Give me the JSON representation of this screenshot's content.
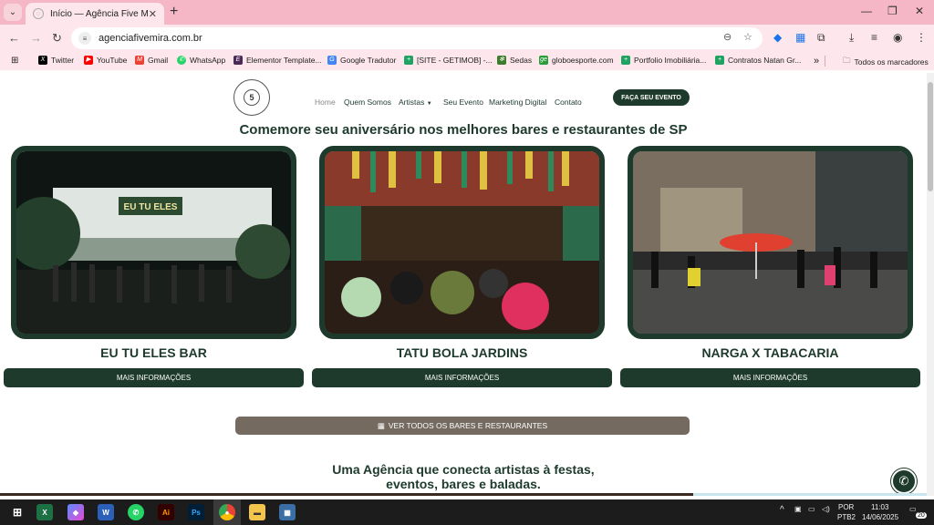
{
  "browser": {
    "tab_title": "Início — Agência Five Mira",
    "url": "agenciafivemira.com.br",
    "bookmarks": [
      {
        "label": "Twitter",
        "color": "#000000",
        "glyph": "X"
      },
      {
        "label": "YouTube",
        "color": "#ff0000",
        "glyph": "▶"
      },
      {
        "label": "Gmail",
        "color": "#ea4335",
        "glyph": "M"
      },
      {
        "label": "WhatsApp",
        "color": "#25d366",
        "glyph": "✆"
      },
      {
        "label": "Elementor Template...",
        "color": "#4a2a55",
        "glyph": "E"
      },
      {
        "label": "Google Tradutor",
        "color": "#4285f4",
        "glyph": "G"
      },
      {
        "label": "[SITE - GETIMOB] -...",
        "color": "#1ea362",
        "glyph": "+"
      },
      {
        "label": "Sedas",
        "color": "#3a7d2c",
        "glyph": "✻"
      },
      {
        "label": "globoesporte.com",
        "color": "#2a9d3a",
        "glyph": "ge"
      },
      {
        "label": "Portfolio Imobiliária...",
        "color": "#1ea362",
        "glyph": "+"
      },
      {
        "label": "Contratos Natan Gr...",
        "color": "#1ea362",
        "glyph": "+"
      }
    ],
    "more_bookmarks": "»",
    "all_bookmarks": "Todos os marcadores"
  },
  "site": {
    "logo_number": "5",
    "nav": {
      "home": "Home",
      "about": "Quem Somos",
      "artists": "Artistas",
      "event": "Seu Evento",
      "marketing": "Marketing Digital",
      "contact": "Contato"
    },
    "cta": "FAÇA SEU EVENTO",
    "headline": "Comemore seu aniversário nos melhores bares e restaurantes de SP",
    "cards": [
      {
        "title": "EU TU ELES BAR",
        "button": "MAIS INFORMAÇÕES",
        "sign": "EU TU ELES"
      },
      {
        "title": "TATU BOLA JARDINS",
        "button": "MAIS INFORMAÇÕES"
      },
      {
        "title": "NARGA X TABACARIA",
        "button": "MAIS INFORMAÇÕES"
      }
    ],
    "see_all": "VER TODOS OS BARES E RESTAURANTES",
    "tagline_line1": "Uma Agência que conecta artistas à festas,",
    "tagline_line2": "eventos, bares e baladas."
  },
  "taskbar": {
    "lang": "POR",
    "layout": "PTB2",
    "time": "11:03",
    "date": "14/06/2025",
    "notifications": "20"
  },
  "colors": {
    "brand_green": "#1d3a2c",
    "see_all_brown": "#756a60",
    "tab_pink": "#f5b6c6"
  }
}
